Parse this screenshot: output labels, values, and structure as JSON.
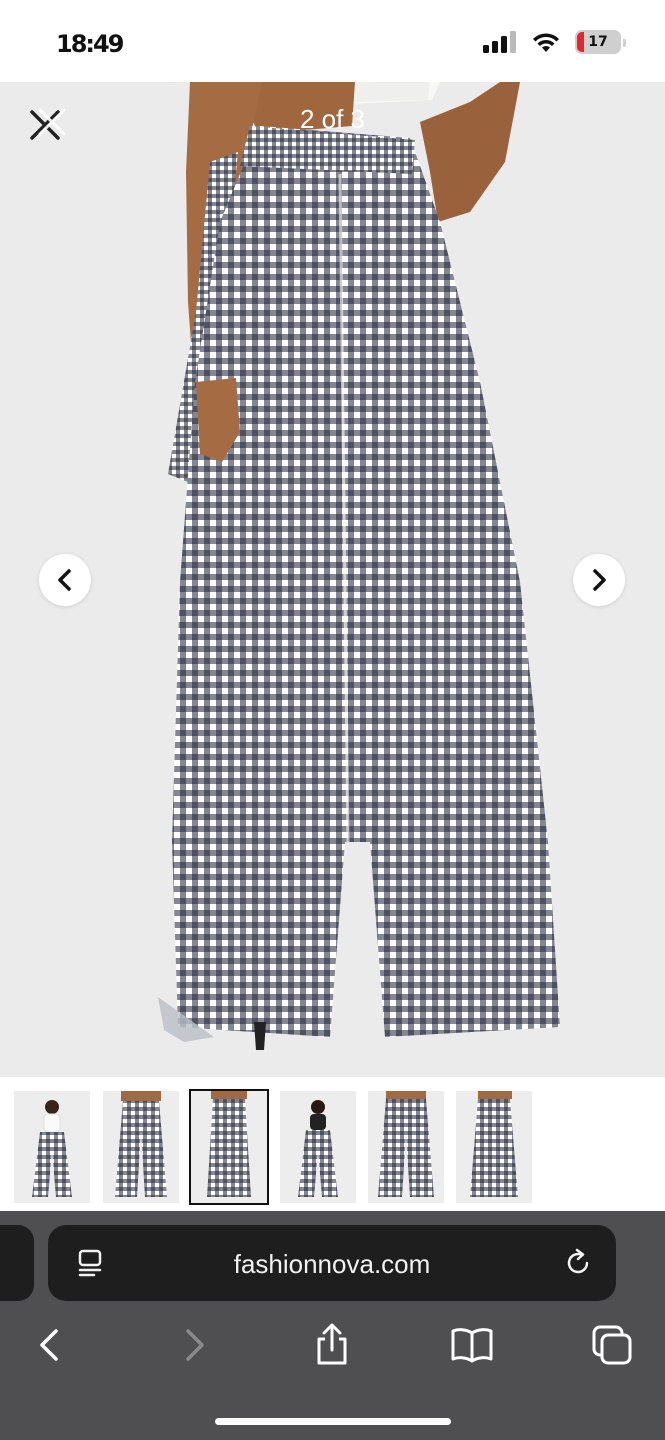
{
  "status_bar": {
    "time": "18:49",
    "battery_percent": "17",
    "battery_level": 0.17
  },
  "viewer": {
    "counter": "2 of 3",
    "close_icon": "close-icon",
    "prev_icon": "chevron-left-icon",
    "next_icon": "chevron-right-icon"
  },
  "thumbnails": {
    "count": 6,
    "selected_index": 2,
    "items": [
      {
        "view": "front-full"
      },
      {
        "view": "front-tie"
      },
      {
        "view": "back"
      },
      {
        "view": "front-full-alt"
      },
      {
        "view": "front-tie-close"
      },
      {
        "view": "back-alt"
      }
    ]
  },
  "browser": {
    "url": "fashionnova.com",
    "page_menu_icon": "page-menu-icon",
    "reload_icon": "reload-icon",
    "toolbar": [
      "back-icon",
      "forward-icon",
      "share-icon",
      "bookmarks-icon",
      "tabs-icon"
    ]
  },
  "colors": {
    "status_bar_bg": "#ffffff",
    "viewer_bg": "#ecebeb",
    "gingham_navy": "#1f2438",
    "browser_chrome": "#4f4f51",
    "url_bar": "#1e1e1f",
    "battery_red": "#e5262c"
  }
}
